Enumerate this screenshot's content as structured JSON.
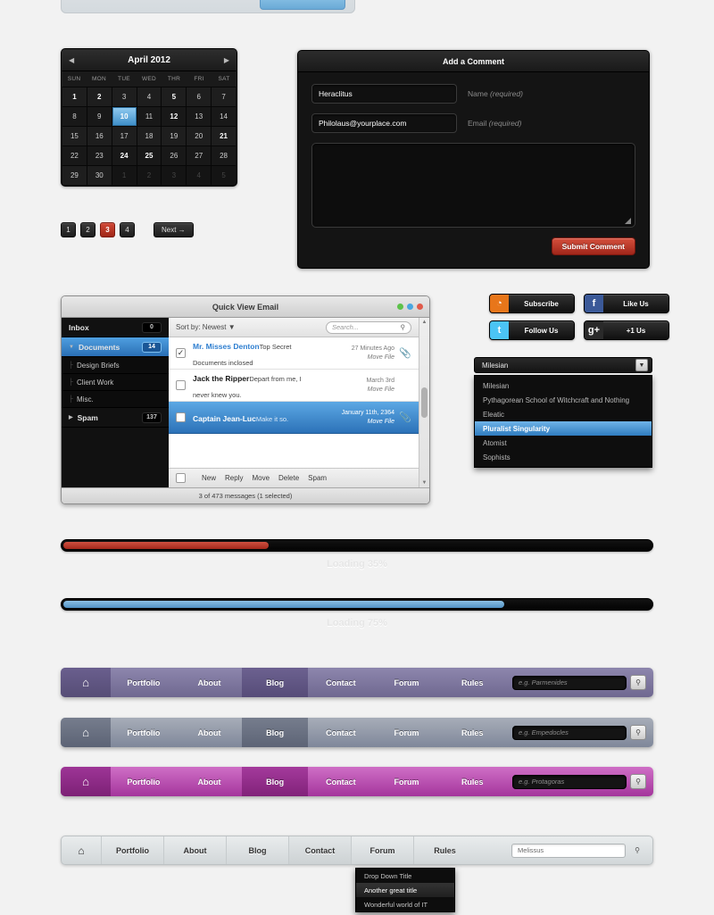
{
  "calendar": {
    "title": "April 2012",
    "prev_icon": "triangle-left-icon",
    "next_icon": "triangle-right-icon",
    "dow": [
      "SUN",
      "MON",
      "TUE",
      "WED",
      "THR",
      "FRI",
      "SAT"
    ],
    "weeks": [
      [
        {
          "d": "1",
          "s": "bold"
        },
        {
          "d": "2",
          "s": "bold"
        },
        {
          "d": "3",
          "s": ""
        },
        {
          "d": "4",
          "s": ""
        },
        {
          "d": "5",
          "s": "bold"
        },
        {
          "d": "6",
          "s": ""
        },
        {
          "d": "7",
          "s": ""
        }
      ],
      [
        {
          "d": "8",
          "s": ""
        },
        {
          "d": "9",
          "s": ""
        },
        {
          "d": "10",
          "s": "sel"
        },
        {
          "d": "11",
          "s": ""
        },
        {
          "d": "12",
          "s": "bold"
        },
        {
          "d": "13",
          "s": ""
        },
        {
          "d": "14",
          "s": ""
        }
      ],
      [
        {
          "d": "15",
          "s": ""
        },
        {
          "d": "16",
          "s": ""
        },
        {
          "d": "17",
          "s": ""
        },
        {
          "d": "18",
          "s": ""
        },
        {
          "d": "19",
          "s": ""
        },
        {
          "d": "20",
          "s": ""
        },
        {
          "d": "21",
          "s": "bold"
        }
      ],
      [
        {
          "d": "22",
          "s": ""
        },
        {
          "d": "23",
          "s": ""
        },
        {
          "d": "24",
          "s": "bold"
        },
        {
          "d": "25",
          "s": "bold"
        },
        {
          "d": "26",
          "s": ""
        },
        {
          "d": "27",
          "s": ""
        },
        {
          "d": "28",
          "s": ""
        }
      ],
      [
        {
          "d": "29",
          "s": ""
        },
        {
          "d": "30",
          "s": ""
        },
        {
          "d": "1",
          "s": "dim"
        },
        {
          "d": "2",
          "s": "dim"
        },
        {
          "d": "3",
          "s": "dim"
        },
        {
          "d": "4",
          "s": "dim"
        },
        {
          "d": "5",
          "s": "dim"
        }
      ]
    ]
  },
  "pagination": {
    "pages": [
      "1",
      "2",
      "3",
      "4"
    ],
    "active": "3",
    "next_label": "Next →",
    "active_color": "#b93a2e"
  },
  "comment_form": {
    "title": "Add a Comment",
    "name_value": "Heraclitus",
    "name_label_text": "Name ",
    "name_label_req": "(required)",
    "email_value": "Philolaus@yourplace.com",
    "email_label_text": "Email ",
    "email_label_req": "(required)",
    "message_value": "",
    "submit_label": "Submit Comment",
    "submit_color": "#b93226"
  },
  "email_client": {
    "title": "Quick View Email",
    "window_dots": [
      "#5dc24a",
      "#49a6e0",
      "#e05a4a"
    ],
    "sidebar": [
      {
        "label": "Inbox",
        "count": "0",
        "selected": false,
        "tri": "",
        "sub": false
      },
      {
        "label": "Documents",
        "count": "14",
        "selected": true,
        "tri": "▼",
        "sub": false
      },
      {
        "label": "Design Briefs",
        "count": "",
        "selected": false,
        "tri": "",
        "sub": true
      },
      {
        "label": "Client Work",
        "count": "",
        "selected": false,
        "tri": "",
        "sub": true
      },
      {
        "label": "Misc.",
        "count": "",
        "selected": false,
        "tri": "",
        "sub": true
      },
      {
        "label": "Spam",
        "count": "137",
        "selected": false,
        "tri": "▶",
        "sub": false
      }
    ],
    "sort_label": "Sort by: Newest ▼",
    "search_placeholder": "Search...",
    "messages": [
      {
        "from": "Mr. Misses Denton",
        "snippet": "Top Secret Documents inclosed",
        "date": "27 Minutes Ago",
        "action": "Move File",
        "checked": true,
        "selected": false,
        "attachment": true
      },
      {
        "from": "Jack the Ripper",
        "snippet": "Depart from me, I never knew you.",
        "date": "March 3rd",
        "action": "Move File",
        "checked": false,
        "selected": false,
        "attachment": false
      },
      {
        "from": "Captain Jean-Luc",
        "snippet": "Make it so.",
        "date": "January 11th, 2364",
        "action": "Move File",
        "checked": false,
        "selected": true,
        "attachment": true
      }
    ],
    "actions": [
      "New",
      "Reply",
      "Move",
      "Delete",
      "Spam"
    ],
    "status": "3 of 473 messages (1 selected)"
  },
  "social_buttons": [
    {
      "label": "Subscribe",
      "icon": "rss-icon",
      "glyph": "◔",
      "color": "#e8761a"
    },
    {
      "label": "Like Us",
      "icon": "facebook-icon",
      "glyph": "f",
      "color": "#3b5998"
    },
    {
      "label": "Follow Us",
      "icon": "twitter-icon",
      "glyph": "t",
      "color": "#4bc4f5"
    },
    {
      "label": "+1 Us",
      "icon": "google-plus-icon",
      "glyph": "g+",
      "color": "#2a2a2a"
    }
  ],
  "select_dropdown": {
    "selected": "Milesian",
    "arrow_icon": "chevron-down-icon",
    "options": [
      {
        "label": "Milesian",
        "highlighted": false
      },
      {
        "label": "Pythagorean School of Witchcraft and Nothing",
        "highlighted": false
      },
      {
        "label": "Eleatic",
        "highlighted": false
      },
      {
        "label": "Pluralist Singularity",
        "highlighted": true
      },
      {
        "label": "Atomist",
        "highlighted": false
      },
      {
        "label": "Sophists",
        "highlighted": false
      }
    ]
  },
  "progress_bars": [
    {
      "label": "Loading 35%",
      "percent": 35,
      "color": "#b93a2e",
      "variant": "red"
    },
    {
      "label": "Loading 75%",
      "percent": 75,
      "color": "#5191c4",
      "variant": "blue"
    }
  ],
  "navbars": [
    {
      "theme": "purple",
      "home_icon": "home-icon",
      "items": [
        "Portfolio",
        "About",
        "Blog",
        "Contact",
        "Forum",
        "Rules"
      ],
      "active": "Blog",
      "search_placeholder": "e.g. Parmenides",
      "search_icon": "search-icon"
    },
    {
      "theme": "slate",
      "home_icon": "home-icon",
      "items": [
        "Portfolio",
        "About",
        "Blog",
        "Contact",
        "Forum",
        "Rules"
      ],
      "active": "Blog",
      "search_placeholder": "e.g. Empedocles",
      "search_icon": "search-icon"
    },
    {
      "theme": "magenta",
      "home_icon": "home-icon",
      "items": [
        "Portfolio",
        "About",
        "Blog",
        "Contact",
        "Forum",
        "Rules"
      ],
      "active": "Blog",
      "search_placeholder": "e.g. Protagoras",
      "search_icon": "search-icon"
    },
    {
      "theme": "light",
      "home_icon": "home-icon",
      "items": [
        "Portfolio",
        "About",
        "Blog",
        "Contact",
        "Forum",
        "Rules"
      ],
      "active": "Contact",
      "search_value": "Melissus",
      "search_icon": "search-icon"
    }
  ],
  "nav_dropdown": {
    "items": [
      {
        "label": "Drop Down Title",
        "hover": false
      },
      {
        "label": "Another great title",
        "hover": true
      },
      {
        "label": "Wonderful world of IT",
        "hover": false
      }
    ]
  }
}
